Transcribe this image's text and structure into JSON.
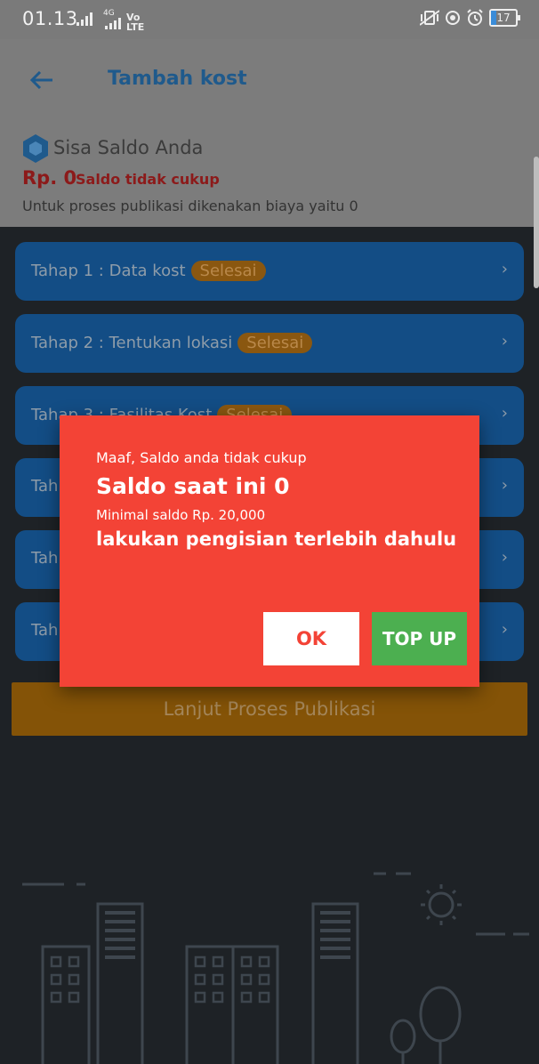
{
  "status_bar": {
    "time": "01.13",
    "network_1": "4G",
    "network_2": "Vo LTE",
    "battery": "17"
  },
  "toolbar": {
    "back_icon": "arrow-left-icon",
    "title": "Tambah kost"
  },
  "saldo": {
    "icon": "hexagon-logo-icon",
    "title": "Sisa Saldo Anda",
    "amount": "Rp. 0",
    "warning": "Saldo tidak cukup",
    "fee_note": "Untuk proses publikasi dikenakan biaya yaitu 0"
  },
  "steps": [
    {
      "label": "Tahap 1 : Data kost",
      "badge": "Selesai"
    },
    {
      "label": "Tahap 2 : Tentukan lokasi",
      "badge": "Selesai"
    },
    {
      "label": "Tahap 3 : Fasilitas Kost",
      "badge": "Selesai"
    },
    {
      "label": "Tah",
      "badge": ""
    },
    {
      "label": "Tah",
      "badge": ""
    },
    {
      "label": "Tah",
      "badge": ""
    }
  ],
  "chevron": "›",
  "publish_button": "Lanjut Proses Publikasi",
  "dialog": {
    "line1": "Maaf, Saldo anda tidak cukup",
    "line2": "Saldo saat ini 0",
    "line3": "Minimal saldo Rp. 20,000",
    "line4": "lakukan pengisian terlebih dahulu",
    "ok": "OK",
    "topup": "TOP UP"
  },
  "colors": {
    "dialog_bg": "#f34336",
    "topup_bg": "#4caf50",
    "step_bg": "#134d85",
    "publish_bg": "#845307"
  }
}
